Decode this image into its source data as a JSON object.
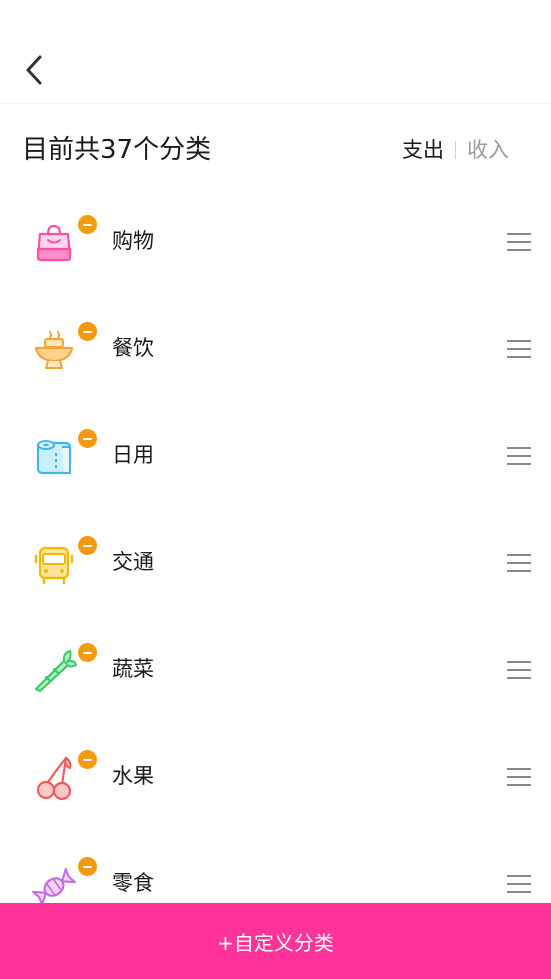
{
  "header": {
    "summary": "目前共37个分类",
    "tabs": [
      {
        "label": "支出",
        "active": true
      },
      {
        "label": "收入",
        "active": false
      }
    ]
  },
  "categories": [
    {
      "label": "购物",
      "icon": "shopping-bag-icon"
    },
    {
      "label": "餐饮",
      "icon": "dining-bowl-icon"
    },
    {
      "label": "日用",
      "icon": "toilet-paper-icon"
    },
    {
      "label": "交通",
      "icon": "bus-icon"
    },
    {
      "label": "蔬菜",
      "icon": "carrot-icon"
    },
    {
      "label": "水果",
      "icon": "cherry-icon"
    },
    {
      "label": "零食",
      "icon": "candy-icon"
    }
  ],
  "footer": {
    "button_label": "+自定义分类"
  },
  "colors": {
    "accent": "#ff3399",
    "remove_badge": "#f59a0f",
    "inactive_tab": "#9a9a9a"
  }
}
